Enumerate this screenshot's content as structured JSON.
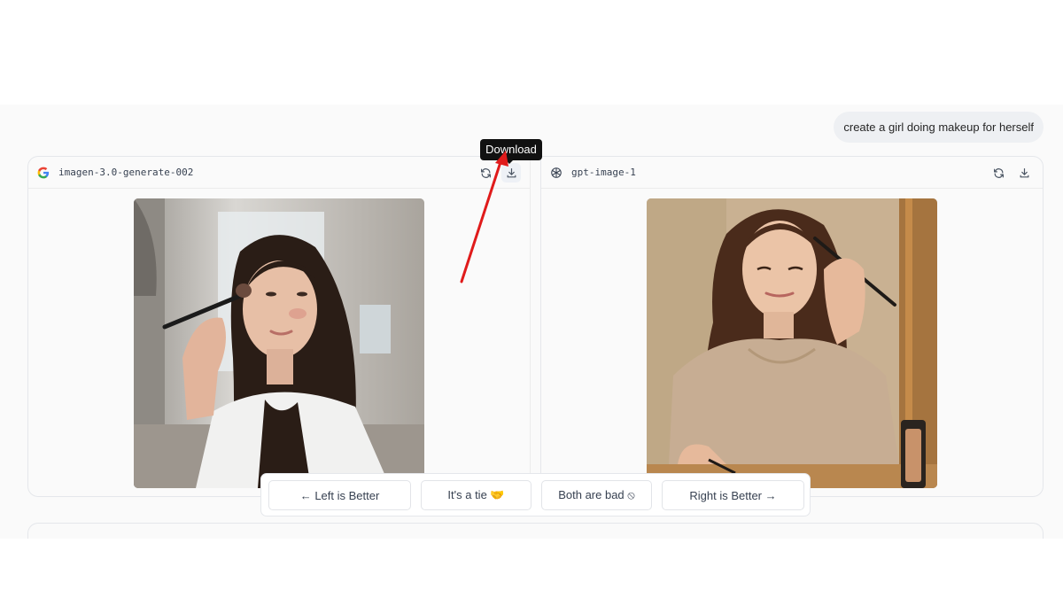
{
  "prompt": {
    "text": "create a girl doing makeup for herself"
  },
  "left_panel": {
    "model_name": "imagen-3.0-generate-002",
    "logo_icon": "google-g-icon",
    "image_alt": "A woman with long dark hair applying blush with a makeup brush in front of a bathroom mirror"
  },
  "right_panel": {
    "model_name": "gpt-image-1",
    "logo_icon": "openai-logo-icon",
    "image_alt": "A woman with closed eyes applying eyeliner with a pencil in front of a wooden-framed mirror"
  },
  "tooltip": {
    "download": "Download"
  },
  "vote": {
    "left_better": "← Left is Better",
    "tie": "It's a tie 🤝",
    "both_bad": "Both are bad ⦸",
    "right_better": "Right is Better →"
  },
  "colors": {
    "annotation_arrow": "#e01b1b",
    "tooltip_bg": "#111111",
    "panel_border": "#e5e7eb",
    "page_bg": "#fafafa"
  }
}
